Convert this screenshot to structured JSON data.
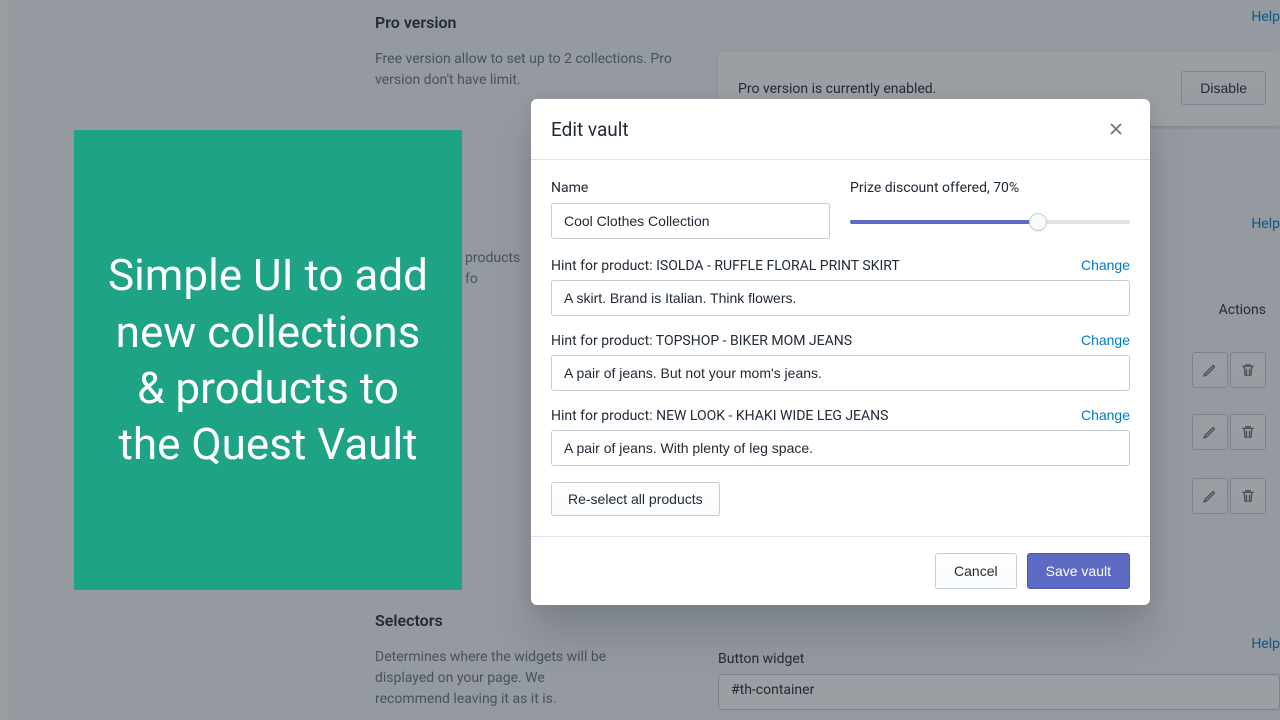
{
  "background": {
    "pro_heading": "Pro version",
    "pro_desc": "Free version allow to set up to 2 collections. Pro version don't have limit.",
    "pro_status": "Pro version is currently enabled.",
    "disable_btn": "Disable",
    "products_snippet": "products fo",
    "selectors_heading": "Selectors",
    "selectors_desc": "Determines where the widgets will be displayed on your page. We recommend leaving it as it is.",
    "button_widget_label": "Button widget",
    "button_widget_value": "#th-container",
    "help": "Help",
    "actions_col": "Actions"
  },
  "teal_text": "Simple UI to add new collections & products to the Quest Vault",
  "modal": {
    "title": "Edit vault",
    "name_label": "Name",
    "name_value": "Cool Clothes Collection",
    "slider_label": "Prize discount offered, 70%",
    "slider_percent": 70,
    "hints": [
      {
        "label": "Hint for product: ISOLDA - RUFFLE FLORAL PRINT SKIRT",
        "value": "A skirt. Brand is Italian. Think flowers."
      },
      {
        "label": "Hint for product: TOPSHOP - BIKER MOM JEANS",
        "value": "A pair of jeans. But not your mom's jeans."
      },
      {
        "label": "Hint for product: NEW LOOK - KHAKI WIDE LEG JEANS",
        "value": "A pair of jeans. With plenty of leg space."
      }
    ],
    "change": "Change",
    "reselect": "Re-select all products",
    "cancel": "Cancel",
    "save": "Save vault"
  }
}
